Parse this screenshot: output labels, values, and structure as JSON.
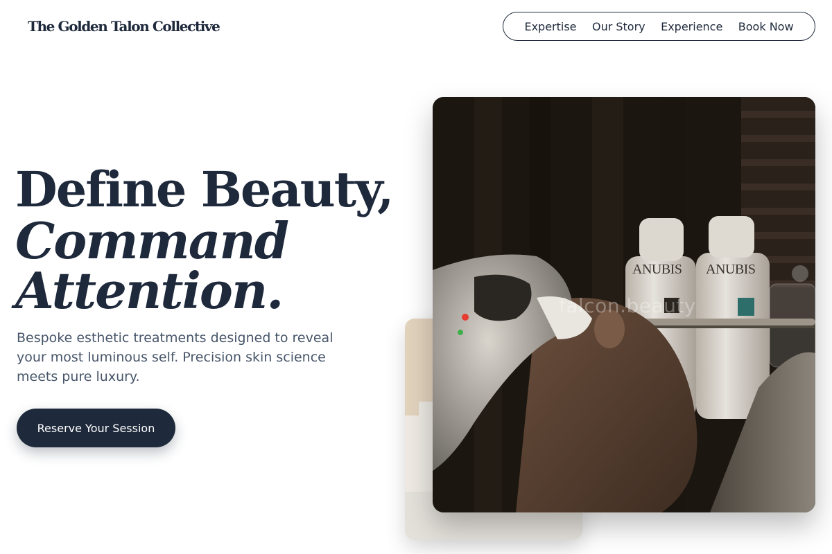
{
  "brand": {
    "name": "The Golden Talon Collective"
  },
  "nav": {
    "items": [
      {
        "label": "Expertise"
      },
      {
        "label": "Our Story"
      },
      {
        "label": "Experience"
      },
      {
        "label": "Book Now"
      }
    ]
  },
  "hero": {
    "headline_line1": "Define Beauty,",
    "headline_line2": "Command",
    "headline_line3": "Attention.",
    "subtext": "Bespoke esthetic treatments designed to reveal your most luminous self. Precision skin science meets pure luxury.",
    "cta_label": "Reserve Your Session"
  },
  "image": {
    "watermark": "falcon.beauty",
    "bottle_brand_left": "ANUBIS",
    "bottle_brand_right": "ANUBIS"
  },
  "colors": {
    "primary": "#1e293b",
    "body_text": "#475569",
    "background": "#ffffff"
  }
}
